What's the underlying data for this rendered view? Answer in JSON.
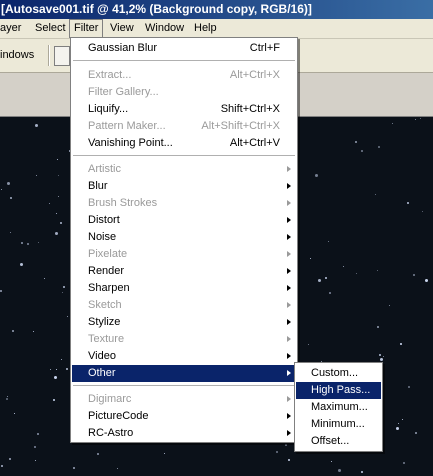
{
  "window": {
    "title": "[Autosave001.tif @ 41,2% (Background copy, RGB/16)]"
  },
  "menubar": {
    "items": [
      "ayer",
      "Select",
      "Filter",
      "View",
      "Window",
      "Help"
    ]
  },
  "options_bar": {
    "windows_label": "indows"
  },
  "filter_menu": {
    "gaussian_blur": {
      "label": "Gaussian Blur",
      "shortcut": "Ctrl+F"
    },
    "extract": {
      "label": "Extract...",
      "shortcut": "Alt+Ctrl+X"
    },
    "filter_gallery": {
      "label": "Filter Gallery..."
    },
    "liquify": {
      "label": "Liquify...",
      "shortcut": "Shift+Ctrl+X"
    },
    "pattern_maker": {
      "label": "Pattern Maker...",
      "shortcut": "Alt+Shift+Ctrl+X"
    },
    "vanishing_point": {
      "label": "Vanishing Point...",
      "shortcut": "Alt+Ctrl+V"
    },
    "artistic": "Artistic",
    "blur": "Blur",
    "brush_strokes": "Brush Strokes",
    "distort": "Distort",
    "noise": "Noise",
    "pixelate": "Pixelate",
    "render": "Render",
    "sharpen": "Sharpen",
    "sketch": "Sketch",
    "stylize": "Stylize",
    "texture": "Texture",
    "video": "Video",
    "other": "Other",
    "digimarc": "Digimarc",
    "picturecode": "PictureCode",
    "rc_astro": "RC-Astro"
  },
  "other_submenu": {
    "custom": "Custom...",
    "high_pass": "High Pass...",
    "maximum": "Maximum...",
    "minimum": "Minimum...",
    "offset": "Offset..."
  },
  "colors": {
    "menu_highlight": "#0a246a",
    "menubar": "#ece9d8",
    "disabled_text": "#9a9a9a",
    "title_start": "#0a246a",
    "title_end": "#3a6ea5"
  }
}
